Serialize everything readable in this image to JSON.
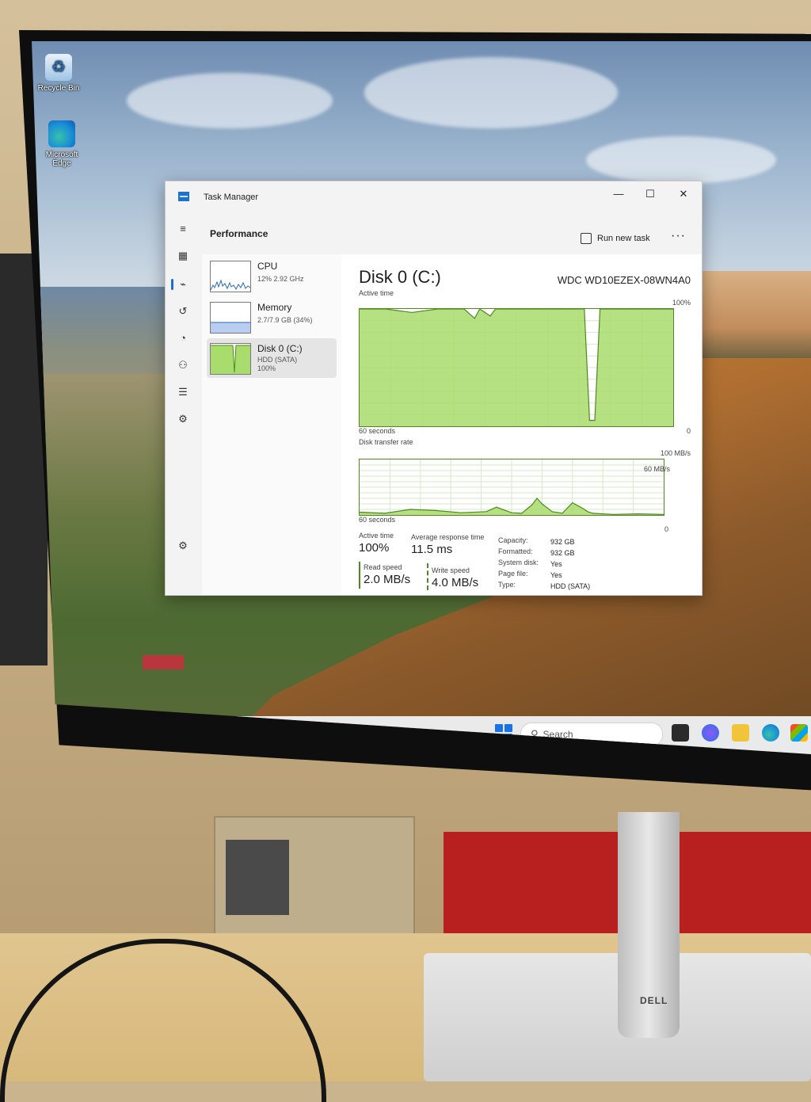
{
  "desktop": {
    "icons": [
      {
        "label": "Recycle Bin"
      },
      {
        "label_line1": "Microsoft",
        "label_line2": "Edge"
      }
    ]
  },
  "taskbar": {
    "search_placeholder": "Search"
  },
  "window": {
    "title": "Task Manager",
    "controls": {
      "minimize": "—",
      "maximize": "☐",
      "close": "✕"
    }
  },
  "header": {
    "title": "Performance",
    "run_new_task": "Run new task",
    "more": "···"
  },
  "devices": [
    {
      "name": "CPU",
      "detail": "12% 2.92 GHz",
      "selected": false
    },
    {
      "name": "Memory",
      "detail": "2.7/7.9 GB (34%)",
      "selected": false
    },
    {
      "name": "Disk 0 (C:)",
      "detail": "HDD (SATA)",
      "detail2": "100%",
      "selected": true
    }
  ],
  "disk": {
    "title": "Disk 0 (C:)",
    "model": "WDC WD10EZEX-08WN4A0",
    "active_time_label": "Active time",
    "active_time_max": "100%",
    "active_time_window": "60 seconds",
    "active_time_min": "0",
    "transfer_label": "Disk transfer rate",
    "transfer_max": "100 MB/s",
    "transfer_mid": "60 MB/s",
    "transfer_window": "60 seconds",
    "transfer_min": "0"
  },
  "stats": {
    "active_time": {
      "label": "Active time",
      "value": "100%"
    },
    "avg_response": {
      "label": "Average response time",
      "value": "11.5 ms"
    },
    "read_speed": {
      "label": "Read speed",
      "value": "2.0 MB/s"
    },
    "write_speed": {
      "label": "Write speed",
      "value": "4.0 MB/s"
    }
  },
  "properties": [
    {
      "key": "Capacity:",
      "value": "932 GB"
    },
    {
      "key": "Formatted:",
      "value": "932 GB"
    },
    {
      "key": "System disk:",
      "value": "Yes"
    },
    {
      "key": "Page file:",
      "value": "Yes"
    },
    {
      "key": "Type:",
      "value": "HDD (SATA)"
    }
  ],
  "colors": {
    "disk_fill": "#a8dc6c",
    "disk_line": "#4f8a1d",
    "accent": "#1f6fd1"
  },
  "chart_data": [
    {
      "type": "area",
      "title": "Active time",
      "ylim": [
        0,
        100
      ],
      "x": [
        60,
        55,
        50,
        45,
        40,
        38,
        37,
        35,
        34,
        33,
        30,
        28,
        25,
        20,
        17,
        16,
        15,
        14,
        10,
        5,
        0
      ],
      "series": [
        {
          "values": [
            100,
            100,
            97,
            100,
            100,
            92,
            100,
            94,
            100,
            100,
            100,
            100,
            100,
            100,
            100,
            5,
            5,
            100,
            100,
            100,
            100
          ]
        }
      ]
    },
    {
      "type": "area",
      "title": "Disk transfer rate",
      "ylim": [
        0,
        100
      ],
      "x": [
        60,
        55,
        50,
        45,
        40,
        35,
        33,
        30,
        28,
        26,
        25,
        24,
        22,
        20,
        18,
        16,
        15,
        14,
        12,
        10,
        5,
        0
      ],
      "series": [
        {
          "values": [
            5,
            3,
            10,
            8,
            4,
            6,
            14,
            4,
            3,
            18,
            30,
            20,
            6,
            3,
            22,
            12,
            6,
            3,
            2,
            1,
            2,
            1
          ]
        }
      ]
    }
  ]
}
